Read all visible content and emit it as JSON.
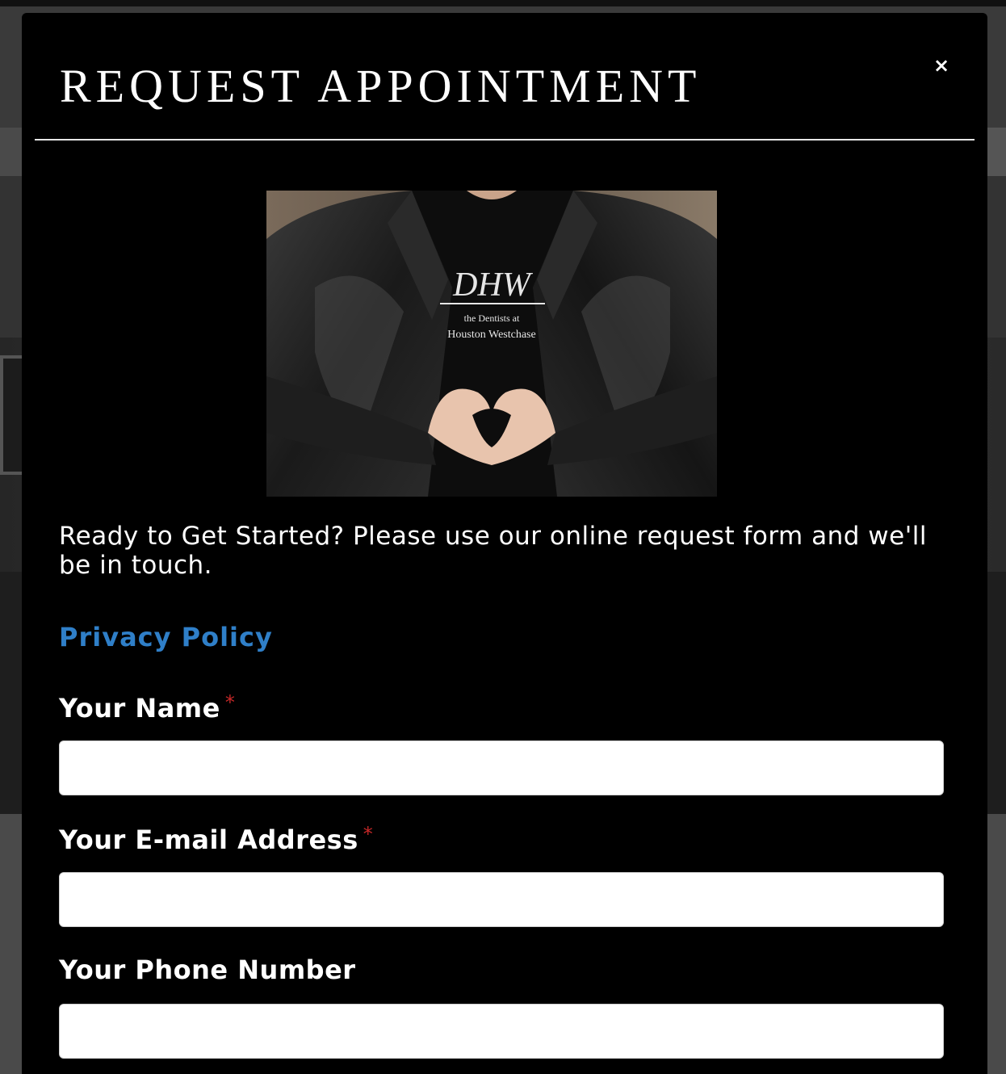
{
  "modal": {
    "title": "REQUEST APPOINTMENT",
    "close_label": "×",
    "photo_alt": "Person in leather jacket making heart shape with hands",
    "photo_logo_monogram": "DHW",
    "photo_logo_line1": "the Dentists at",
    "photo_logo_line2": "Houston Westchase",
    "intro_text": "Ready to Get Started? Please use our online request form and we'll be in touch.",
    "privacy_link": "Privacy Policy",
    "required_mark": "*",
    "fields": [
      {
        "label": "Your Name",
        "required": true,
        "value": "",
        "placeholder": ""
      },
      {
        "label": "Your E-mail Address",
        "required": true,
        "value": "",
        "placeholder": ""
      },
      {
        "label": "Your Phone Number",
        "required": false,
        "value": "",
        "placeholder": ""
      }
    ]
  },
  "colors": {
    "modal_bg": "#000000",
    "link": "#2f7fc8",
    "required": "#c62828",
    "text": "#ffffff"
  }
}
